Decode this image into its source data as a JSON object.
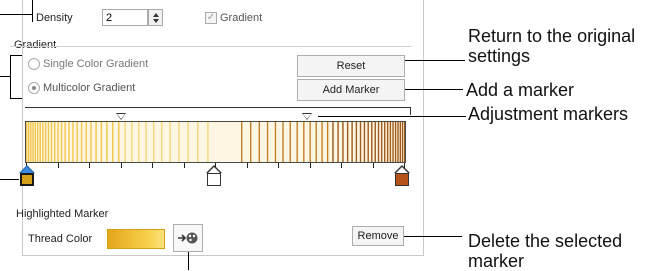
{
  "density": {
    "label": "Density",
    "value": "2"
  },
  "gradient_toggle": {
    "label": "Gradient",
    "checked": true
  },
  "gradient_group": {
    "title": "Gradient",
    "options": [
      {
        "label": "Single Color Gradient",
        "selected": false
      },
      {
        "label": "Multicolor Gradient",
        "selected": true
      }
    ],
    "reset_label": "Reset",
    "add_marker_label": "Add Marker"
  },
  "gradient_bar": {
    "colors": {
      "left": "#f2c64a",
      "middle": "#f7e6a8",
      "right": "#c47f2a",
      "right_dark": "#a05a1a"
    },
    "color_markers": [
      {
        "fill": "#d4a017",
        "selected": true
      },
      {
        "fill": "#ffffff",
        "selected": false
      },
      {
        "fill": "#b5531b",
        "selected": false
      }
    ]
  },
  "highlighted": {
    "title": "Highlighted Marker",
    "thread_label": "Thread Color",
    "thread_color": "#f0b92e",
    "remove_label": "Remove",
    "picker_icon": "color-picker-icon"
  },
  "callouts": {
    "reset": "Return to the original settings",
    "add_marker": "Add a marker",
    "adjustment": "Adjustment markers",
    "remove": "Delete the selected marker"
  }
}
